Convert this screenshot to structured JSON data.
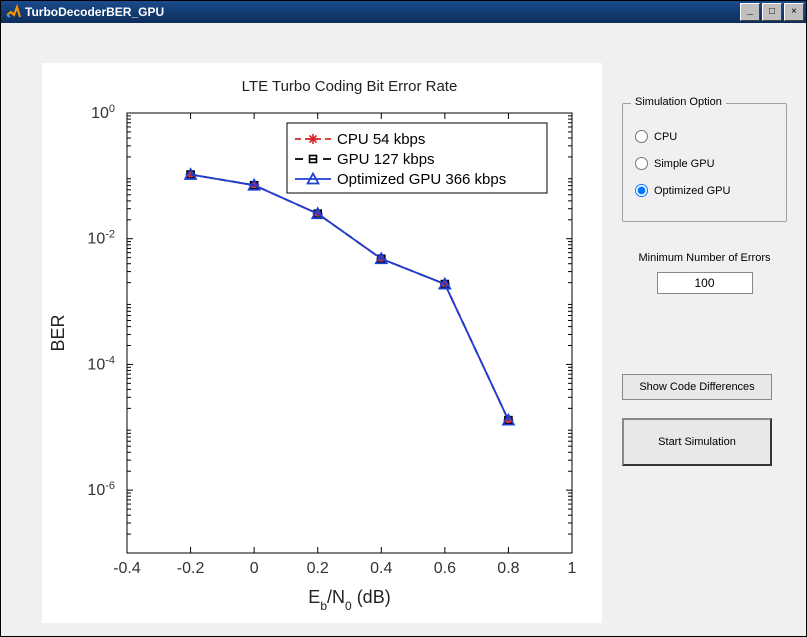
{
  "window": {
    "title": "TurboDecoderBER_GPU",
    "min_label": "_",
    "max_label": "□",
    "close_label": "×"
  },
  "chart_data": {
    "type": "line",
    "title": "LTE Turbo Coding Bit Error Rate",
    "xlabel": "E_b/N_0 (dB)",
    "ylabel": "BER",
    "xlim": [
      -0.4,
      1.0
    ],
    "ylim_log10": [
      -7,
      0
    ],
    "xticks": [
      "-0.4",
      "-0.2",
      "0",
      "0.2",
      "0.4",
      "0.6",
      "0.8",
      "1"
    ],
    "ytick_exp": [
      0,
      -2,
      -4,
      -6
    ],
    "x": [
      -0.2,
      0.0,
      0.2,
      0.4,
      0.6,
      0.8
    ],
    "series": [
      {
        "name": "CPU 54 kbps",
        "color": "#d62728",
        "marker": "star",
        "dash": "6,4",
        "values": [
          0.105,
          0.071,
          0.025,
          0.0048,
          0.0019,
          1.3e-05
        ]
      },
      {
        "name": "GPU 127 kbps",
        "color": "#000000",
        "marker": "square",
        "dash": "8,6",
        "values": [
          0.105,
          0.071,
          0.025,
          0.0048,
          0.0019,
          1.3e-05
        ]
      },
      {
        "name": "Optimized GPU 366 kbps",
        "color": "#1f3fd4",
        "marker": "triangle",
        "dash": "",
        "values": [
          0.105,
          0.071,
          0.025,
          0.0048,
          0.0019,
          1.3e-05
        ]
      }
    ]
  },
  "sim_option": {
    "title": "Simulation Option",
    "items": [
      {
        "label": "CPU",
        "checked": false
      },
      {
        "label": "Simple GPU",
        "checked": false
      },
      {
        "label": "Optimized GPU",
        "checked": true
      }
    ]
  },
  "min_errors": {
    "label": "Minimum Number of Errors",
    "value": "100"
  },
  "buttons": {
    "show_diff": "Show Code Differences",
    "start": "Start Simulation"
  }
}
